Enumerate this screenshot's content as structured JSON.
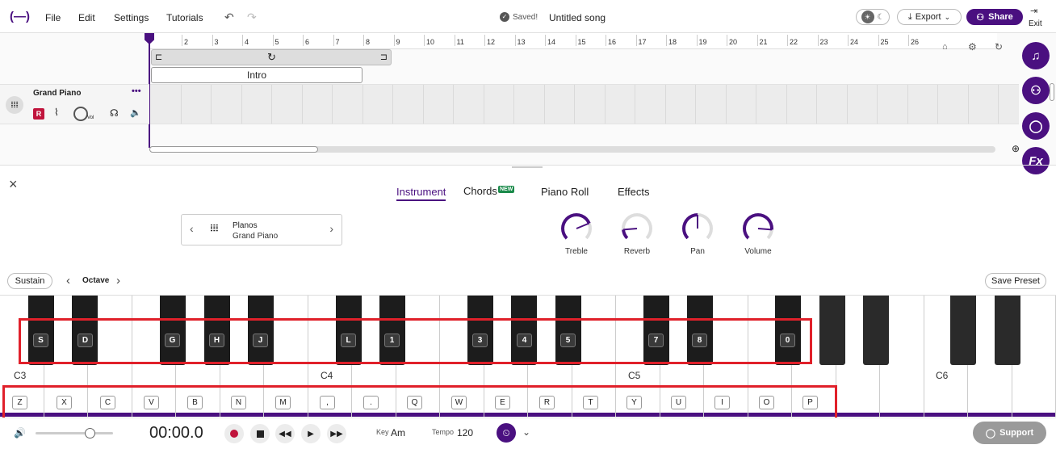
{
  "topbar": {
    "logo": "(—)",
    "menu": [
      "File",
      "Edit",
      "Settings",
      "Tutorials"
    ],
    "saved_status": "Saved!",
    "song_title": "Untitled song",
    "export_label": "Export",
    "share_label": "Share",
    "exit_label": "Exit"
  },
  "arrangement": {
    "ruler_numbers": [
      "2",
      "3",
      "4",
      "5",
      "6",
      "7",
      "8",
      "9",
      "10",
      "11",
      "12",
      "13",
      "14",
      "15",
      "16",
      "17",
      "18",
      "19",
      "20",
      "21",
      "22",
      "23",
      "24",
      "25",
      "26"
    ],
    "region_label": "Intro",
    "track_name": "Grand Piano",
    "track_badge": "R",
    "vol_label": "Vol",
    "more_label": "•••"
  },
  "side_buttons": [
    "music-note",
    "collaborators",
    "chat",
    "Fx"
  ],
  "panel": {
    "tabs": [
      "Instrument",
      "Chords",
      "Piano Roll",
      "Effects"
    ],
    "new_badge": "NEW",
    "active_tab": "Instrument",
    "instrument_category": "Planos",
    "instrument_name": "Grand Piano",
    "knobs": [
      {
        "label": "Treble",
        "value": 0.75
      },
      {
        "label": "Reverb",
        "value": 0.15
      },
      {
        "label": "Pan",
        "value": 0.5
      },
      {
        "label": "Volume",
        "value": 0.85
      }
    ],
    "sustain_label": "Sustain",
    "octave_label": "Octave",
    "save_preset_label": "Save Preset"
  },
  "keyboard": {
    "octave_labels": [
      "C3",
      "C4",
      "C5",
      "C6"
    ],
    "white_keys": [
      "Z",
      "X",
      "C",
      "V",
      "B",
      "N",
      "M",
      ",",
      ".",
      "Q",
      "W",
      "E",
      "R",
      "T",
      "Y",
      "U",
      "I",
      "O",
      "P"
    ],
    "black_keys": [
      "S",
      "D",
      "G",
      "H",
      "J",
      "L",
      "1",
      "3",
      "4",
      "5",
      "7",
      "8",
      "0"
    ]
  },
  "transport": {
    "time": "00:00.0",
    "key_label": "Key",
    "key_value": "Am",
    "tempo_label": "Tempo",
    "tempo_value": "120",
    "volume_level": 0.7,
    "support_label": "Support"
  },
  "colors": {
    "accent": "#4a1080",
    "record": "#c0143c",
    "highlight": "#e0202a"
  }
}
